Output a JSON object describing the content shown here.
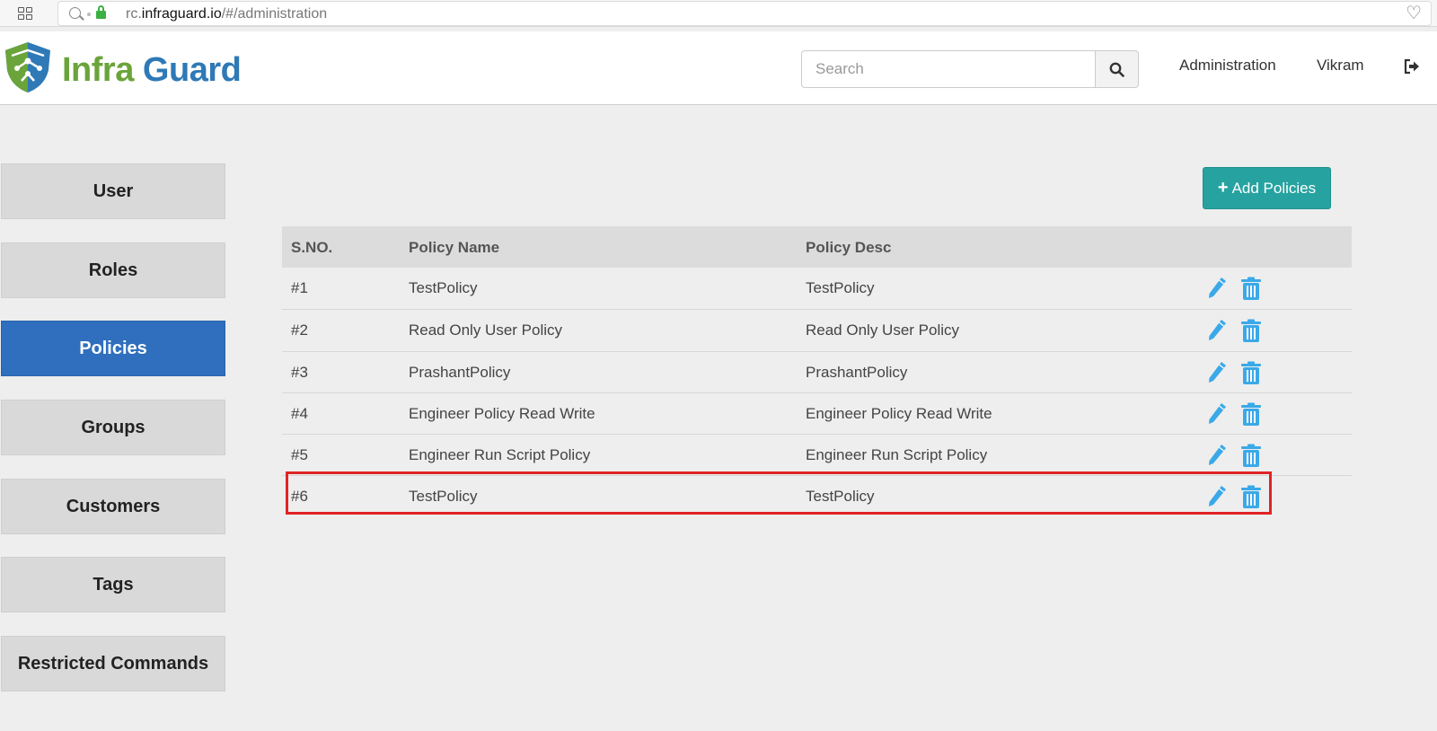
{
  "browser": {
    "url_prefix": "rc.",
    "url_domain": "infraguard.io",
    "url_path": "/#/administration"
  },
  "header": {
    "brand_word1": "Infra",
    "brand_word2": "Guard",
    "search_placeholder": "Search",
    "nav_administration": "Administration",
    "nav_user": "Vikram"
  },
  "sidebar": {
    "items": [
      {
        "label": "User",
        "active": false
      },
      {
        "label": "Roles",
        "active": false
      },
      {
        "label": "Policies",
        "active": true
      },
      {
        "label": "Groups",
        "active": false
      },
      {
        "label": "Customers",
        "active": false
      },
      {
        "label": "Tags",
        "active": false
      },
      {
        "label": "Restricted Commands",
        "active": false
      }
    ]
  },
  "toolbar": {
    "add_label": "Add Policies"
  },
  "table": {
    "headers": [
      "S.NO.",
      "Policy Name",
      "Policy Desc"
    ],
    "rows": [
      {
        "sno": "#1",
        "name": "TestPolicy",
        "desc": "TestPolicy"
      },
      {
        "sno": "#2",
        "name": "Read Only User Policy",
        "desc": "Read Only User Policy"
      },
      {
        "sno": "#3",
        "name": "PrashantPolicy",
        "desc": "PrashantPolicy"
      },
      {
        "sno": "#4",
        "name": "Engineer Policy Read Write",
        "desc": "Engineer Policy Read Write"
      },
      {
        "sno": "#5",
        "name": "Engineer Run Script Policy",
        "desc": "Engineer Run Script Policy"
      },
      {
        "sno": "#6",
        "name": "TestPolicy",
        "desc": "TestPolicy"
      }
    ]
  },
  "colors": {
    "brand_green": "#6aa43a",
    "brand_blue": "#2f79b6",
    "active_nav": "#2f6fbd",
    "add_button": "#26a3a0",
    "action_icon": "#3aa9e8",
    "highlight": "#e02424"
  }
}
